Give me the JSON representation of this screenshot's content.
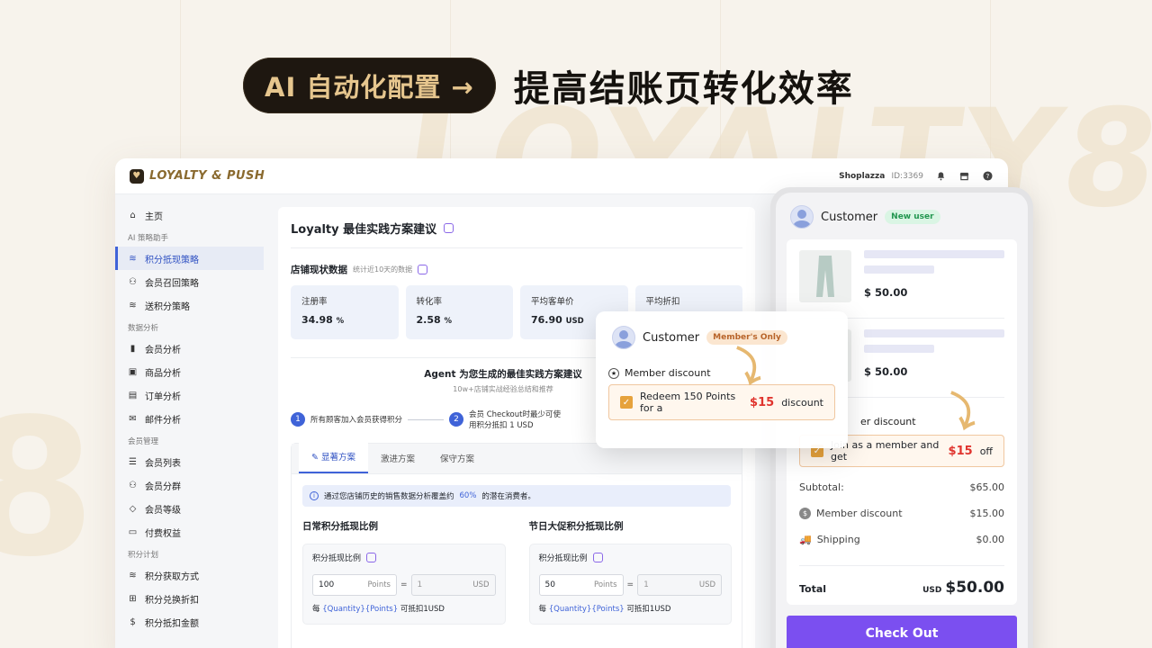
{
  "hero": {
    "pill": "AI 自动化配置 →",
    "title": "提高结账页转化效率"
  },
  "background": {
    "watermark": "LOYALTY8",
    "watermark2": "8"
  },
  "app": {
    "brand": "LOYALTY & PUSH",
    "store": "Shoplazza",
    "store_id": "ID:3369"
  },
  "sidebar": {
    "home": "主页",
    "group1": "AI 策略助手",
    "items1": [
      "积分抵现策略",
      "会员召回策略",
      "送积分策略"
    ],
    "group2": "数据分析",
    "items2": [
      "会员分析",
      "商品分析",
      "订单分析",
      "邮件分析"
    ],
    "group3": "会员管理",
    "items3": [
      "会员列表",
      "会员分群",
      "会员等级",
      "付费权益"
    ],
    "group4": "积分计划",
    "items4": [
      "积分获取方式",
      "积分兑换折扣",
      "积分抵扣金额"
    ]
  },
  "main": {
    "title": "Loyalty 最佳实践方案建议",
    "store_data_title": "店铺现状数据",
    "store_data_sub": "统计近10天的数据",
    "stats": [
      {
        "label": "注册率",
        "value": "34.98",
        "unit": "%"
      },
      {
        "label": "转化率",
        "value": "2.58",
        "unit": "%"
      },
      {
        "label": "平均客单价",
        "value": "76.90",
        "unit": "USD"
      },
      {
        "label": "平均折扣",
        "value": "",
        "unit": ""
      }
    ],
    "agent_title": "Agent 为您生成的最佳实践方案建议",
    "agent_sub": "10w+店铺实战经验总结和推荐",
    "steps": [
      {
        "num": "1",
        "text": "所有顾客加入会员获得积分"
      },
      {
        "num": "2",
        "text": "会员 Checkout时最少可使用积分抵扣 1 USD"
      }
    ],
    "tabs": [
      "显著方案",
      "激进方案",
      "保守方案"
    ],
    "info_pre": "通过您店铺历史的销售数据分析覆盖约",
    "info_pct": "60%",
    "info_post": "的潜在消费者。",
    "ratio_cols": [
      {
        "title": "日常积分抵现比例",
        "label": "积分抵现比例",
        "points": "100",
        "points_unit": "Points",
        "eq": "=",
        "usd": "1",
        "usd_unit": "USD"
      },
      {
        "title": "节日大促积分抵现比例",
        "label": "积分抵现比例",
        "points": "50",
        "points_unit": "Points",
        "eq": "=",
        "usd": "1",
        "usd_unit": "USD"
      }
    ],
    "note_pre": "每",
    "note_var": "{Quantity}{Points}",
    "note_post": "可抵扣1USD"
  },
  "phone": {
    "customer": "Customer",
    "badge": "New user",
    "price1": "$ 50.00",
    "price2": "$ 50.00",
    "member_discount_partial": "er discount",
    "join_pre": "Join as a member and get",
    "join_amt": "$15",
    "join_post": "off",
    "subtotal_label": "Subtotal:",
    "subtotal": "$65.00",
    "md_label": "Member discount",
    "md_value": "$15.00",
    "ship_label": "Shipping",
    "ship_value": "$0.00",
    "total_label": "Total",
    "total_cur": "USD",
    "total_value": "$50.00",
    "checkout": "Check Out"
  },
  "popup": {
    "customer": "Customer",
    "badge": "Member's Only",
    "md": "Member discount",
    "redeem_pre": "Redeem 150 Points for a",
    "redeem_amt": "$15",
    "redeem_post": "discount"
  },
  "colors": {
    "accent": "#3f63d8",
    "checkout": "#7b4ff0",
    "gold": "#e6c68e"
  }
}
